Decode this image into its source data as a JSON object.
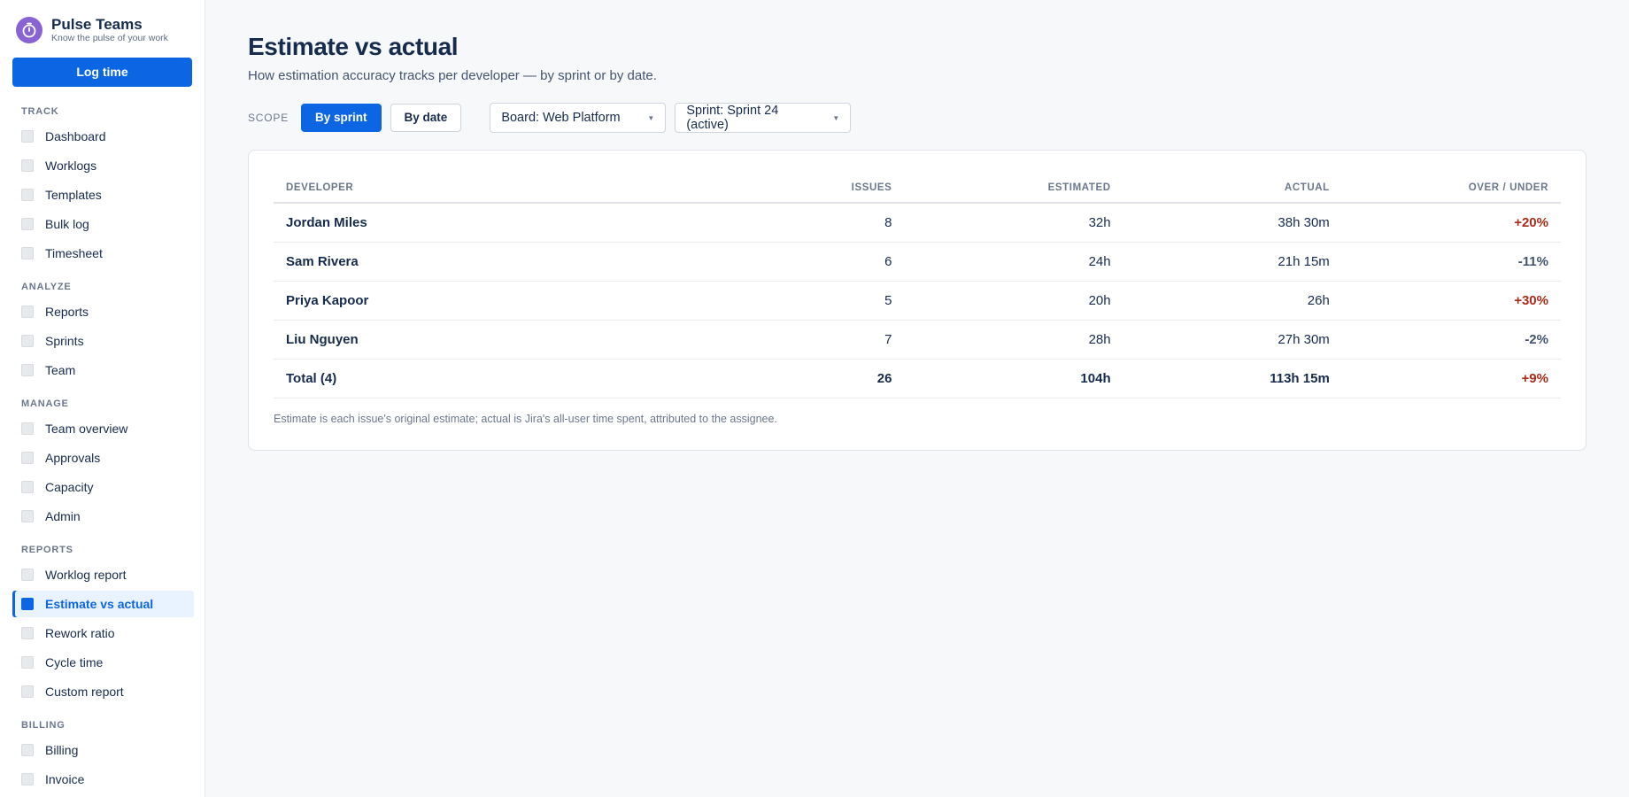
{
  "brand": {
    "name": "Pulse Teams",
    "tagline": "Know the pulse of your work"
  },
  "sidebar": {
    "log_time_label": "Log time",
    "sections": [
      {
        "title": "TRACK",
        "items": [
          "Dashboard",
          "Worklogs",
          "Templates",
          "Bulk log",
          "Timesheet"
        ]
      },
      {
        "title": "ANALYZE",
        "items": [
          "Reports",
          "Sprints",
          "Team"
        ]
      },
      {
        "title": "MANAGE",
        "items": [
          "Team overview",
          "Approvals",
          "Capacity",
          "Admin"
        ]
      },
      {
        "title": "REPORTS",
        "items": [
          "Worklog report",
          "Estimate vs actual",
          "Rework ratio",
          "Cycle time",
          "Custom report"
        ]
      },
      {
        "title": "BILLING",
        "items": [
          "Billing",
          "Invoice"
        ]
      }
    ],
    "active_item": "Estimate vs actual"
  },
  "page": {
    "title": "Estimate vs actual",
    "subtitle": "How estimation accuracy tracks per developer — by sprint or by date."
  },
  "toolbar": {
    "scope_label": "SCOPE",
    "by_sprint_label": "By sprint",
    "by_date_label": "By date",
    "active_scope": "By sprint",
    "board_select": "Board: Web Platform",
    "sprint_select": "Sprint: Sprint 24 (active)"
  },
  "table": {
    "headers": [
      "DEVELOPER",
      "ISSUES",
      "ESTIMATED",
      "ACTUAL",
      "OVER / UNDER"
    ],
    "rows": [
      {
        "developer": "Jordan Miles",
        "issues": "8",
        "estimated": "32h",
        "actual": "38h 30m",
        "over_under": "+20%"
      },
      {
        "developer": "Sam Rivera",
        "issues": "6",
        "estimated": "24h",
        "actual": "21h 15m",
        "over_under": "-11%"
      },
      {
        "developer": "Priya Kapoor",
        "issues": "5",
        "estimated": "20h",
        "actual": "26h",
        "over_under": "+30%"
      },
      {
        "developer": "Liu Nguyen",
        "issues": "7",
        "estimated": "28h",
        "actual": "27h 30m",
        "over_under": "-2%"
      }
    ],
    "total": {
      "developer": "Total (4)",
      "issues": "26",
      "estimated": "104h",
      "actual": "113h 15m",
      "over_under": "+9%"
    },
    "note": "Estimate is each issue's original estimate; actual is Jira's all-user time spent, attributed to the assignee."
  },
  "colors": {
    "accent": "#0c66e4",
    "over": "#ae2a19",
    "under": "#44546f",
    "brand_logo": "#8a63d2"
  },
  "icons": {
    "brand": "stopwatch-icon",
    "nav": "square-icon",
    "select": "caret-down-icon"
  }
}
